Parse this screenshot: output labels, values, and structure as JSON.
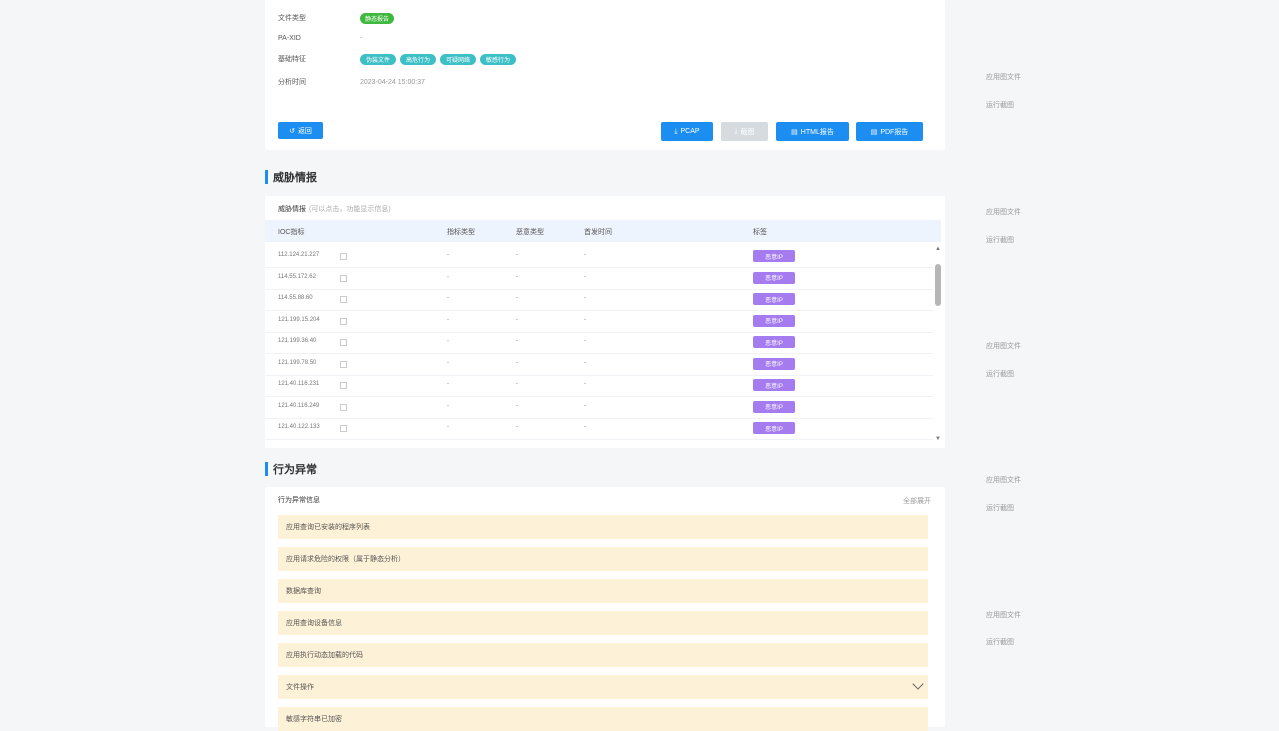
{
  "info": {
    "file_type": {
      "label": "文件类型",
      "value": "静态报告"
    },
    "pa_id": {
      "label": "PA-XID",
      "value": "-"
    },
    "basic_features": {
      "label": "基础特征",
      "tags": [
        "伪装文件",
        "高危行为",
        "可疑网络",
        "敏感行为"
      ]
    },
    "analysis_time": {
      "label": "分析时间",
      "value": "2023-04-24 15:00:37"
    }
  },
  "buttons": {
    "back": "返回",
    "pcap": "PCAP",
    "screenshot": "截图",
    "html_report": "HTML报告",
    "pdf_report": "PDF报告"
  },
  "threat": {
    "section_title": "威胁情报",
    "sub_title": "威胁情报",
    "sub_hint": "(可以点击，功能显示信息)",
    "columns": [
      "IOC指标",
      "指标类型",
      "恶意类型",
      "首发时间",
      "标签"
    ],
    "rows": [
      {
        "ioc": "112.124.21.227",
        "type": "-",
        "mal": "-",
        "first": "-",
        "tag": "恶意IP"
      },
      {
        "ioc": "114.55.172.62",
        "type": "-",
        "mal": "-",
        "first": "-",
        "tag": "恶意IP"
      },
      {
        "ioc": "114.55.88.60",
        "type": "-",
        "mal": "-",
        "first": "-",
        "tag": "恶意IP"
      },
      {
        "ioc": "121.199.15.204",
        "type": "-",
        "mal": "-",
        "first": "-",
        "tag": "恶意IP"
      },
      {
        "ioc": "121.199.36.40",
        "type": "-",
        "mal": "-",
        "first": "-",
        "tag": "恶意IP"
      },
      {
        "ioc": "121.199.78.50",
        "type": "-",
        "mal": "-",
        "first": "-",
        "tag": "恶意IP"
      },
      {
        "ioc": "121.40.116.231",
        "type": "-",
        "mal": "-",
        "first": "-",
        "tag": "恶意IP"
      },
      {
        "ioc": "121.40.116.249",
        "type": "-",
        "mal": "-",
        "first": "-",
        "tag": "恶意IP"
      },
      {
        "ioc": "121.40.122.133",
        "type": "-",
        "mal": "-",
        "first": "-",
        "tag": "恶意IP"
      }
    ]
  },
  "behavior": {
    "section_title": "行为异常",
    "sub_title": "行为异常信息",
    "more": "全部展开",
    "items": [
      "应用查询已安装的程序列表",
      "应用请求危险的权限（属于静态分析）",
      "数据库查询",
      "应用查询设备信息",
      "应用执行动态加载的代码",
      "文件操作",
      "敏感字符串已加密"
    ]
  },
  "rail": {
    "links": [
      "应用图文件",
      "运行截图",
      "应用图文件",
      "运行截图",
      "应用图文件",
      "运行截图",
      "应用图文件",
      "运行截图",
      "应用图文件",
      "运行截图"
    ]
  }
}
